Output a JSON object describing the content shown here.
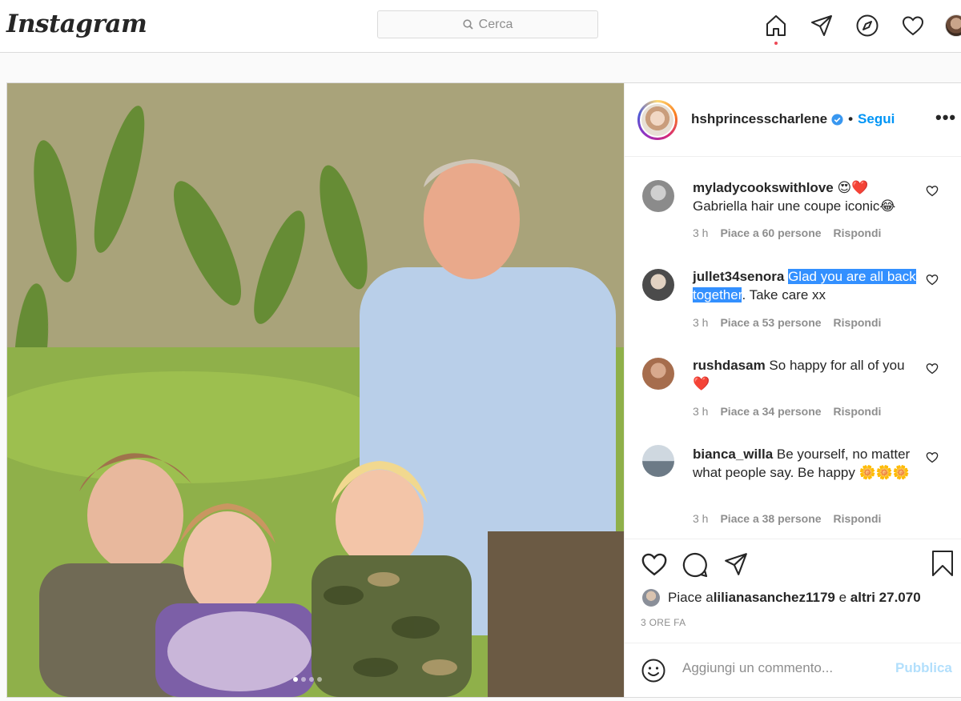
{
  "app": {
    "logo": "Instagram"
  },
  "search": {
    "placeholder": "Cerca"
  },
  "nav": {
    "icons": [
      "home-icon",
      "direct-icon",
      "explore-icon",
      "activity-icon",
      "profile-avatar"
    ]
  },
  "post": {
    "username": "hshprincesscharlene",
    "separator": "•",
    "follow_label": "Segui",
    "more_label": "•••",
    "comments": [
      {
        "user": "myladycookswithlove",
        "text_before": " 😍❤️ Gabriella hair une coupe iconic😂",
        "highlight": "",
        "text_after": "",
        "time": "3 h",
        "likes": "Piace a 60 persone",
        "reply": "Rispondi"
      },
      {
        "user": "jullet34senora",
        "text_before": " ",
        "highlight": "Glad you are all back together",
        "text_after": ". Take care xx",
        "time": "3 h",
        "likes": "Piace a 53 persone",
        "reply": "Rispondi"
      },
      {
        "user": "rushdasam",
        "text_before": " So happy for all of you❤️",
        "highlight": "",
        "text_after": "",
        "time": "3 h",
        "likes": "Piace a 34 persone",
        "reply": "Rispondi"
      },
      {
        "user": "bianca_willa",
        "text_before": " Be yourself, no matter what people say. Be happy 🌼🌼🌼",
        "highlight": "",
        "text_after": "",
        "time": "3 h",
        "likes": "Piace a 38 persone",
        "reply": "Rispondi"
      }
    ],
    "likes_prefix": "Piace a ",
    "likes_user": "lilianasanchez1179",
    "likes_mid": " e ",
    "likes_others": "altri 27.070",
    "time_ago": "3 ORE FA",
    "add_comment_placeholder": "Aggiungi un commento...",
    "publish_label": "Pubblica",
    "carousel": {
      "count": 4,
      "active": 0
    }
  },
  "colors": {
    "accent": "#0095f6",
    "highlight": "#3390ff",
    "notification": "#ed4956"
  }
}
